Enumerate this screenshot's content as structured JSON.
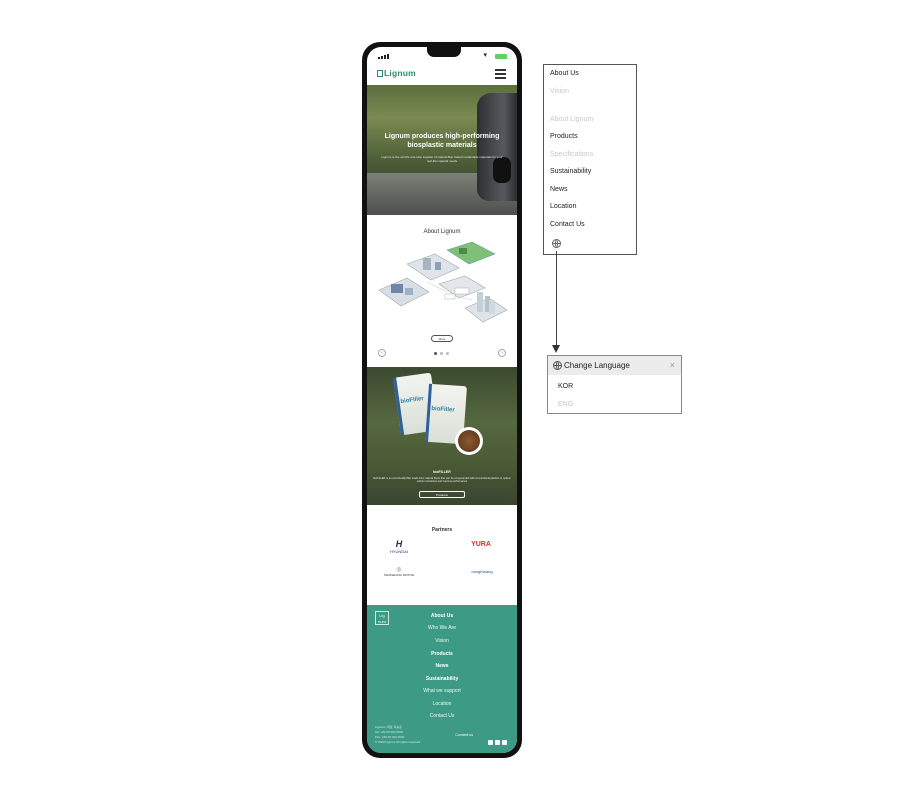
{
  "mobile": {
    "brand": "Lignum",
    "hero": {
      "headline": "Lignum produces high-performing biosplastic materials",
      "subtext": "Lignum is the world's one-stop supplier of natural-fiber based sustainable materials for your real-life material needs"
    },
    "about": {
      "title": "About Lignum",
      "more_label": "More",
      "prev_icon": "arrow-left-icon",
      "next_icon": "arrow-right-icon"
    },
    "product": {
      "bag_label": "bioFiller",
      "title": "bioFILLER",
      "description": "bioFILLER is an eco-friendly filler made from natural fibers that can be compounded with conventional plastics to reduce carbon emissions and improve performance",
      "button_label": "Products"
    },
    "partners": {
      "title": "Partners",
      "items": [
        "HYUNDAI",
        "YURA",
        "SHINSEONG MOTOR",
        "dongKwang"
      ]
    },
    "footer": {
      "logo_text": "Lig num",
      "nav": [
        "About Us",
        "Who We Are",
        "Vision",
        "Products",
        "News",
        "Sustainability",
        "What we support",
        "Location",
        "Contact Us"
      ],
      "info": [
        "Lignum | 대표 이승훈",
        "Tel: +82 00 000 0000",
        "Fax: +82 00 000 0000",
        "© 2023 Lignum All rights reserved"
      ],
      "connect_label": "Connect us"
    }
  },
  "menu_panel": {
    "items": [
      {
        "label": "About Us",
        "muted": false
      },
      {
        "label": "Vision",
        "muted": true
      },
      {
        "label": "About Lignum",
        "muted": true
      },
      {
        "label": "Products",
        "muted": false
      },
      {
        "label": "Specifications",
        "muted": true
      },
      {
        "label": "Sustainability",
        "muted": false
      },
      {
        "label": "News",
        "muted": false
      },
      {
        "label": "Location",
        "muted": false
      },
      {
        "label": "Contact Us",
        "muted": false
      }
    ],
    "globe_icon": "globe-icon"
  },
  "language_panel": {
    "title": "Change Language",
    "close_icon": "close-icon",
    "options": [
      "KOR",
      "ENG"
    ]
  },
  "colors": {
    "brand_green": "#2e8a6e",
    "footer_teal": "#3d9a84"
  }
}
